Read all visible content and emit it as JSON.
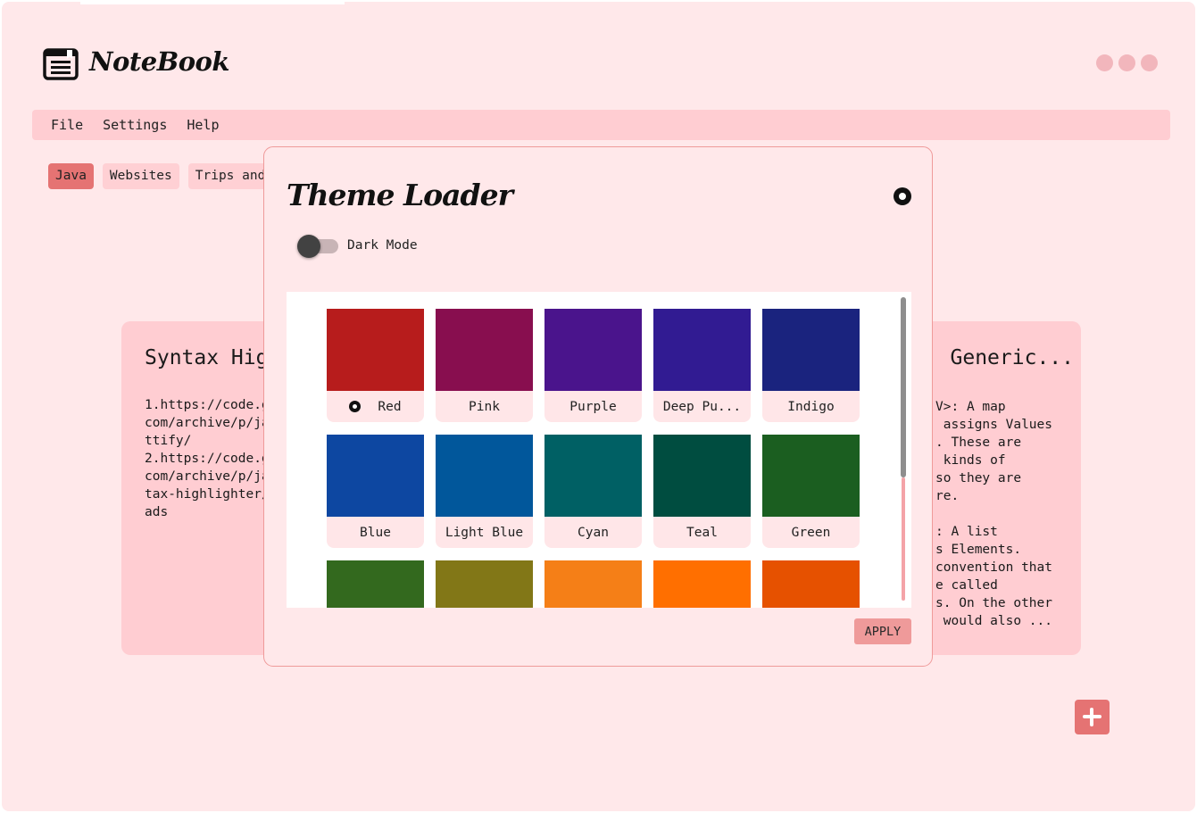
{
  "app": {
    "title": "NoteBook",
    "icon": "notebook-icon",
    "window_controls": [
      "minimize-dot",
      "maximize-dot",
      "close-dot"
    ]
  },
  "menu": {
    "items": [
      "File",
      "Settings",
      "Help"
    ]
  },
  "tabs": [
    {
      "label": "Java",
      "active": true
    },
    {
      "label": "Websites",
      "active": false
    },
    {
      "label": "Trips and",
      "active": false
    }
  ],
  "cards": {
    "left": {
      "title": "Syntax Hig",
      "body": "1.https://code.g\ncom/archive/p/ja\nttify/\n2.https://code.g\ncom/archive/p/ja\ntax-highlighter/\nads"
    },
    "right": {
      "title": "Generic...",
      "body": "V>: A map\n assigns Values\n. These are\n kinds of\nso they are\nre.\n\n: A list\ns Elements.\nconvention that\ne called\ns. On the other\n would also ..."
    }
  },
  "fab": {
    "icon": "plus-icon"
  },
  "dialog": {
    "title": "Theme Loader",
    "close_icon": "close-icon",
    "dark_mode": {
      "label": "Dark Mode",
      "enabled": false
    },
    "apply_label": "APPLY",
    "selected_theme": "Red",
    "themes": [
      {
        "name": "Red",
        "color": "#b71c1c"
      },
      {
        "name": "Pink",
        "color": "#880e4f"
      },
      {
        "name": "Purple",
        "color": "#4a148c"
      },
      {
        "name": "Deep Pu...",
        "color": "#311b92"
      },
      {
        "name": "Indigo",
        "color": "#1a237e"
      },
      {
        "name": "Blue",
        "color": "#0d47a1"
      },
      {
        "name": "Light Blue",
        "color": "#01579b"
      },
      {
        "name": "Cyan",
        "color": "#006064"
      },
      {
        "name": "Teal",
        "color": "#004d40"
      },
      {
        "name": "Green",
        "color": "#1b5e20"
      },
      {
        "name": "",
        "color": "#33691e"
      },
      {
        "name": "",
        "color": "#827717"
      },
      {
        "name": "",
        "color": "#f57f17"
      },
      {
        "name": "",
        "color": "#ff6f00"
      },
      {
        "name": "",
        "color": "#e65100"
      }
    ]
  },
  "colors": {
    "background": "#ffe8ea",
    "menubar": "#ffcdd2",
    "accent": "#e57373",
    "dialog_border": "#ef9a9a"
  }
}
